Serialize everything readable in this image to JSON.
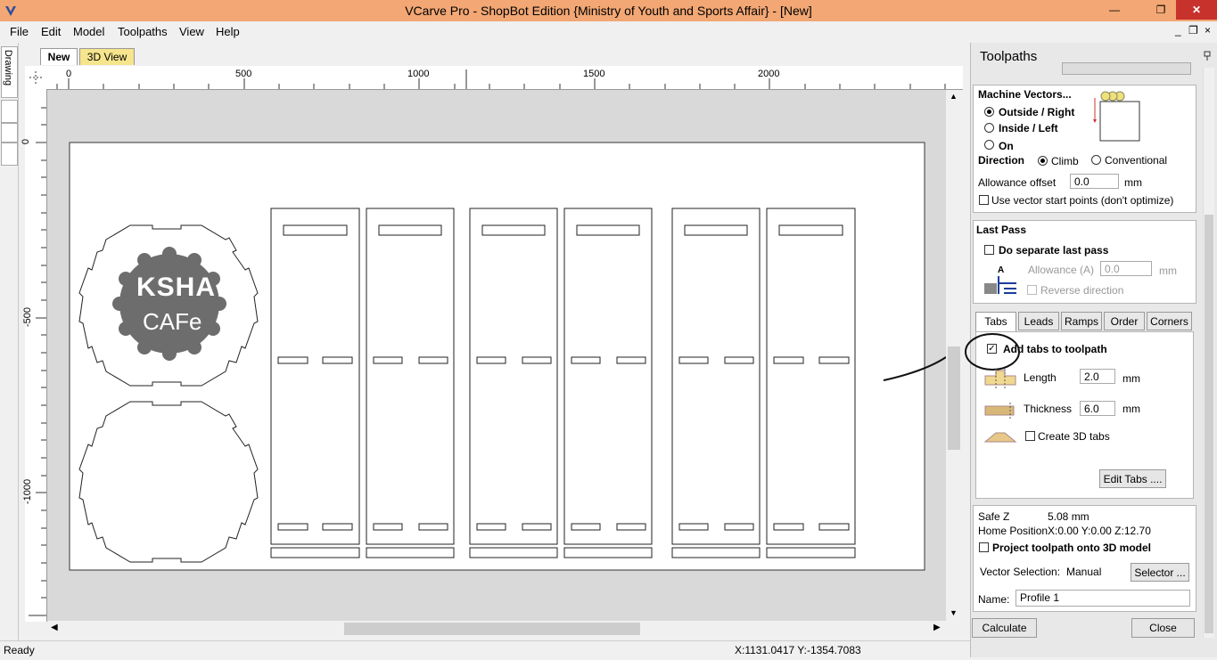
{
  "window": {
    "title": "VCarve Pro - ShopBot Edition {Ministry of Youth and Sports Affair} - [New]",
    "min_label": "—",
    "max_label": "❐",
    "close_label": "✕"
  },
  "menu": {
    "file": "File",
    "edit": "Edit",
    "model": "Model",
    "toolpaths": "Toolpaths",
    "view": "View",
    "help": "Help"
  },
  "panel_controls": {
    "min": "_",
    "restore": "❐",
    "close": "×"
  },
  "left_tab": "Drawing",
  "doc_tabs": {
    "active": "New",
    "other": "3D View"
  },
  "ruler": {
    "h_ticks": [
      "0",
      "500",
      "1000",
      "1500",
      "2000"
    ],
    "v_ticks": [
      "0",
      "-500",
      "-1000"
    ]
  },
  "canvas": {
    "logo_text_top": "KSHA",
    "logo_text_bottom": "CAFe"
  },
  "status": {
    "ready": "Ready",
    "coords": "X:1131.0417 Y:-1354.7083"
  },
  "toolpaths_panel": {
    "title": "Toolpaths",
    "pin": "📌",
    "machine_vectors": {
      "heading": "Machine Vectors...",
      "outside": "Outside / Right",
      "inside": "Inside / Left",
      "on": "On",
      "selected": "outside",
      "direction_label": "Direction",
      "climb": "Climb",
      "conventional": "Conventional",
      "direction_selected": "climb",
      "allowance_label": "Allowance offset",
      "allowance_value": "0.0",
      "allowance_unit": "mm",
      "use_start_points": "Use vector start points (don't optimize)"
    },
    "last_pass": {
      "heading": "Last Pass",
      "separate": "Do separate last pass",
      "allowance_label": "Allowance (A)",
      "allowance_value": "0.0",
      "allowance_unit": "mm",
      "reverse": "Reverse direction"
    },
    "tabs": {
      "labels": [
        "Tabs",
        "Leads",
        "Ramps",
        "Order",
        "Corners"
      ],
      "active": "Tabs",
      "add_tabs": "Add tabs to toolpath",
      "add_tabs_checked": true,
      "length_label": "Length",
      "length_value": "2.0",
      "length_unit": "mm",
      "thickness_label": "Thickness",
      "thickness_value": "6.0",
      "thickness_unit": "mm",
      "create_3d": "Create 3D tabs",
      "edit_tabs": "Edit Tabs ...."
    },
    "footer": {
      "safe_z_label": "Safe Z",
      "safe_z_value": "5.08 mm",
      "home_label": "Home Position",
      "home_value": "X:0.00 Y:0.00 Z:12.70",
      "project": "Project toolpath onto 3D model",
      "vector_selection_label": "Vector Selection:",
      "vector_selection_value": "Manual",
      "selector": "Selector ...",
      "name_label": "Name:",
      "name_value": "Profile 1",
      "calculate": "Calculate",
      "close": "Close"
    }
  }
}
